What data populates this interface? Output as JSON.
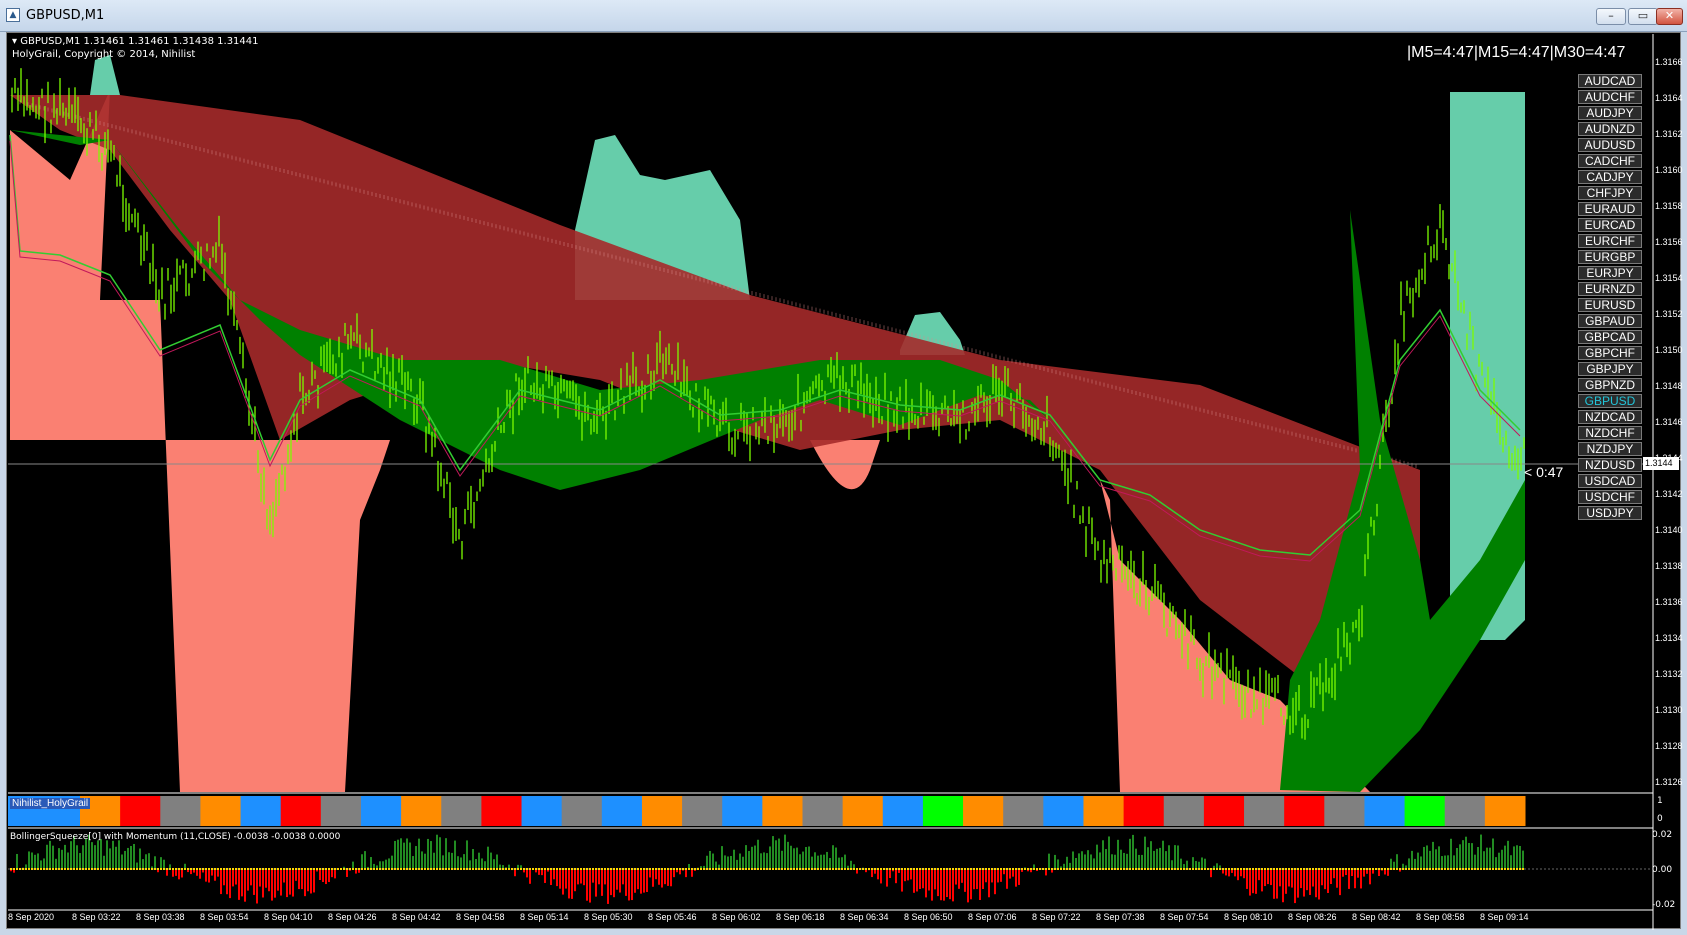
{
  "window": {
    "title": "GBPUSD,M1",
    "controls": [
      "minimize",
      "maximize",
      "close"
    ]
  },
  "chart": {
    "header_line1": "GBPUSD,M1  1.31461 1.31461 1.31438 1.31441",
    "header_line2": "HolyGrail, Copyright © 2014, Nihilist",
    "timer": "|M5=4:47|M15=4:47|M30=4:47",
    "countdown": "< 0:47",
    "current_price": "1.3144",
    "y_ticks": [
      "1.3166",
      "1.3164",
      "1.3162",
      "1.3160",
      "1.3158",
      "1.3156",
      "1.3154",
      "1.3152",
      "1.3150",
      "1.3148",
      "1.3146",
      "1.3144",
      "1.3142",
      "1.3140",
      "1.3138",
      "1.3136",
      "1.3134",
      "1.3132",
      "1.3130",
      "1.3128",
      "1.3126"
    ],
    "x_ticks": [
      "8 Sep 2020",
      "8 Sep 03:22",
      "8 Sep 03:38",
      "8 Sep 03:54",
      "8 Sep 04:10",
      "8 Sep 04:26",
      "8 Sep 04:42",
      "8 Sep 04:58",
      "8 Sep 05:14",
      "8 Sep 05:30",
      "8 Sep 05:46",
      "8 Sep 06:02",
      "8 Sep 06:18",
      "8 Sep 06:34",
      "8 Sep 06:50",
      "8 Sep 07:06",
      "8 Sep 07:22",
      "8 Sep 07:38",
      "8 Sep 07:54",
      "8 Sep 08:10",
      "8 Sep 08:26",
      "8 Sep 08:42",
      "8 Sep 08:58",
      "8 Sep 09:14"
    ],
    "pairs": [
      "AUDCAD",
      "AUDCHF",
      "AUDJPY",
      "AUDNZD",
      "AUDUSD",
      "CADCHF",
      "CADJPY",
      "CHFJPY",
      "EURAUD",
      "EURCAD",
      "EURCHF",
      "EURGBP",
      "EURJPY",
      "EURNZD",
      "EURUSD",
      "GBPAUD",
      "GBPCAD",
      "GBPCHF",
      "GBPJPY",
      "GBPNZD",
      "GBPUSD",
      "NZDCAD",
      "NZDCHF",
      "NZDJPY",
      "NZDUSD",
      "USDCAD",
      "USDCHF",
      "USDJPY"
    ],
    "active_pair": "GBPUSD",
    "colors": {
      "background": "#000000",
      "bull_band": "#008000",
      "bear_band": "#a52a2a",
      "teal_cloud": "#66cdaa",
      "salmon_cloud": "#fa8072",
      "candle": "#7cfc00",
      "lines": "#32cd32"
    }
  },
  "sub1": {
    "label": "Nihilist_HolyGrail",
    "scale": [
      "1",
      "0"
    ],
    "colors": {
      "red": "#ff0000",
      "gray": "#808080",
      "orange": "#ff8c00",
      "blue": "#1e90ff",
      "lime": "#00ff00"
    }
  },
  "sub2": {
    "label": "BollingerSqueeze[0] with Momentum (11,CLOSE) -0.0038 -0.0038 0.0000",
    "scale": [
      "0.02",
      "0.00",
      "-0.02"
    ],
    "colors": {
      "pos": "#228b22",
      "neg": "#ff0000",
      "dots": "#ffd700"
    }
  }
}
